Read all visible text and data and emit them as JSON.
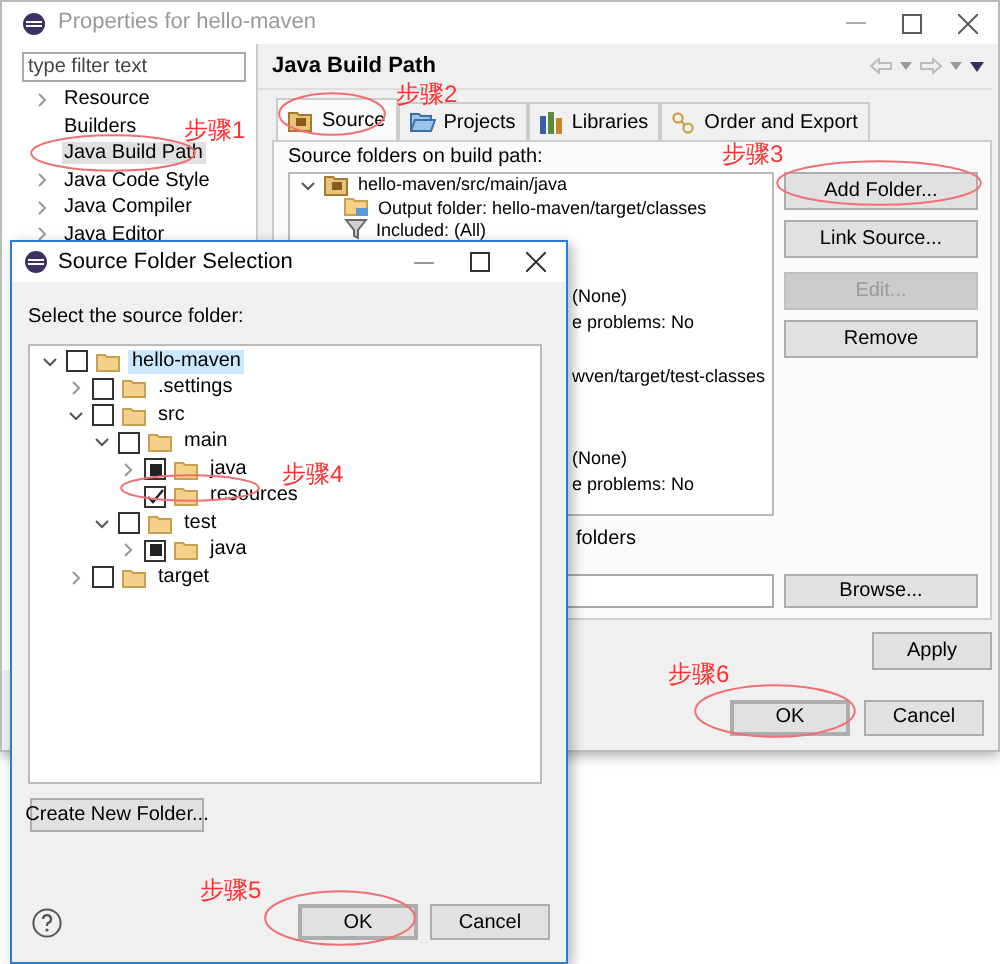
{
  "properties_window": {
    "title": "Properties for hello-maven",
    "filter": {
      "placeholder": "type filter text"
    },
    "nav_items": [
      {
        "label": "Resource",
        "expandable": true,
        "selected": false
      },
      {
        "label": "Builders",
        "expandable": false,
        "selected": false
      },
      {
        "label": "Java Build Path",
        "expandable": false,
        "selected": true
      },
      {
        "label": "Java Code Style",
        "expandable": true,
        "selected": false
      },
      {
        "label": "Java Compiler",
        "expandable": true,
        "selected": false
      },
      {
        "label": "Java Editor",
        "expandable": true,
        "selected": false
      }
    ],
    "page_title": "Java Build Path",
    "tabs": [
      {
        "label": "Source",
        "selected": true
      },
      {
        "label": "Projects",
        "selected": false
      },
      {
        "label": "Libraries",
        "selected": false
      },
      {
        "label": "Order and Export",
        "selected": false
      }
    ],
    "source_label": "Source folders on build path:",
    "source_folders": [
      {
        "label": "hello-maven/src/main/java",
        "expanded": true,
        "children": [
          {
            "label": "Output folder: hello-maven/target/classes"
          },
          {
            "label": "Included: (All)"
          }
        ]
      }
    ],
    "hidden_row_fragments": [
      "(None)",
      "e problems: No",
      "wven/target/test-classes",
      "(None)",
      "e problems: No"
    ],
    "folders_fragment": "folders",
    "side_buttons": [
      {
        "label": "Add Folder...",
        "disabled": false
      },
      {
        "label": "Link Source...",
        "disabled": false
      },
      {
        "label": "Edit...",
        "disabled": true
      },
      {
        "label": "Remove",
        "disabled": false
      }
    ],
    "browse_button": "Browse...",
    "apply_button": "Apply",
    "ok_button": "OK",
    "cancel_button": "Cancel"
  },
  "dialog": {
    "title": "Source Folder Selection",
    "prompt": "Select the source folder:",
    "tree": [
      {
        "label": "hello-maven",
        "checked": false,
        "partial": false,
        "expanded": true,
        "expandable": true,
        "selected": true,
        "children": [
          {
            "label": ".settings",
            "checked": false,
            "partial": false,
            "expanded": false,
            "expandable": true,
            "selected": false
          },
          {
            "label": "src",
            "checked": false,
            "partial": false,
            "expanded": true,
            "expandable": true,
            "selected": false,
            "children": [
              {
                "label": "main",
                "checked": false,
                "partial": false,
                "expanded": true,
                "expandable": true,
                "selected": false,
                "children": [
                  {
                    "label": "java",
                    "checked": false,
                    "partial": true,
                    "expanded": false,
                    "expandable": true,
                    "selected": false
                  },
                  {
                    "label": "resources",
                    "checked": true,
                    "partial": false,
                    "expanded": false,
                    "expandable": false,
                    "selected": false
                  }
                ]
              },
              {
                "label": "test",
                "checked": false,
                "partial": false,
                "expanded": true,
                "expandable": true,
                "selected": false,
                "children": [
                  {
                    "label": "java",
                    "checked": false,
                    "partial": true,
                    "expanded": false,
                    "expandable": true,
                    "selected": false
                  }
                ]
              }
            ]
          },
          {
            "label": "target",
            "checked": false,
            "partial": false,
            "expanded": false,
            "expandable": true,
            "selected": false
          }
        ]
      }
    ],
    "create_button": "Create New Folder...",
    "ok_button": "OK",
    "cancel_button": "Cancel"
  },
  "annotations": [
    {
      "label": "步骤1"
    },
    {
      "label": "步骤2"
    },
    {
      "label": "步骤3"
    },
    {
      "label": "步骤4"
    },
    {
      "label": "步骤5"
    },
    {
      "label": "步骤6"
    }
  ]
}
